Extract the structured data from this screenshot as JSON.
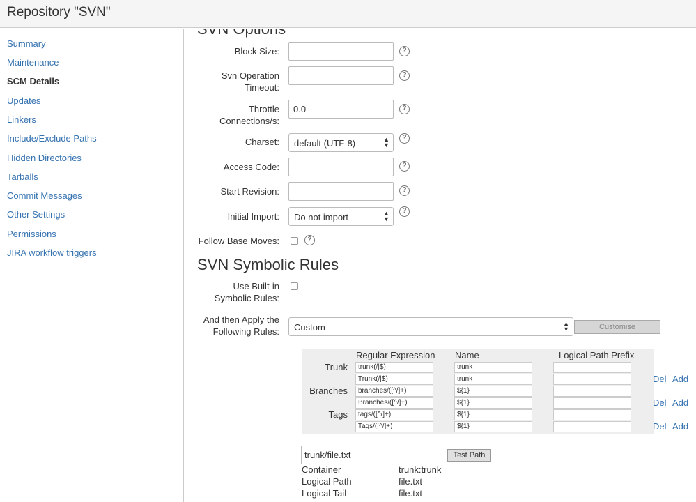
{
  "header": {
    "title": "Repository \"SVN\""
  },
  "sidebar": {
    "items": [
      {
        "label": "Summary",
        "active": false
      },
      {
        "label": "Maintenance",
        "active": false
      },
      {
        "label": "SCM Details",
        "active": true
      },
      {
        "label": "Updates",
        "active": false
      },
      {
        "label": "Linkers",
        "active": false
      },
      {
        "label": "Include/Exclude Paths",
        "active": false
      },
      {
        "label": "Hidden Directories",
        "active": false
      },
      {
        "label": "Tarballs",
        "active": false
      },
      {
        "label": "Commit Messages",
        "active": false
      },
      {
        "label": "Other Settings",
        "active": false
      },
      {
        "label": "Permissions",
        "active": false
      },
      {
        "label": "JIRA workflow triggers",
        "active": false
      }
    ]
  },
  "options": {
    "title": "SVN Options",
    "block_size": {
      "label": "Block Size:",
      "value": ""
    },
    "svn_timeout": {
      "label1": "Svn Operation",
      "label2": "Timeout:",
      "value": ""
    },
    "throttle": {
      "label1": "Throttle",
      "label2": "Connections/s:",
      "value": "0.0"
    },
    "charset": {
      "label": "Charset:",
      "value": "default (UTF-8)"
    },
    "access_code": {
      "label": "Access Code:",
      "value": ""
    },
    "start_revision": {
      "label": "Start Revision:",
      "value": ""
    },
    "initial_import": {
      "label": "Initial Import:",
      "value": "Do not import"
    },
    "follow_base": {
      "label": "Follow Base Moves:",
      "checked": false
    }
  },
  "symbolic": {
    "title": "SVN Symbolic Rules",
    "builtin": {
      "label1": "Use Built-in",
      "label2": "Symbolic Rules:",
      "checked": false
    },
    "apply": {
      "label1": "And then Apply the",
      "label2": "Following Rules:",
      "value": "Custom"
    },
    "customise_label": "Customise",
    "headers": {
      "regex": "Regular Expression",
      "name": "Name",
      "prefix": "Logical Path Prefix"
    },
    "groups": [
      "Trunk",
      "Branches",
      "Tags"
    ],
    "rows": [
      {
        "regex": "trunk(/|$)",
        "name": "trunk",
        "prefix": ""
      },
      {
        "regex": "Trunk(/|$)",
        "name": "trunk",
        "prefix": ""
      },
      {
        "regex": "branches/([^/]+)",
        "name": "${1}",
        "prefix": ""
      },
      {
        "regex": "Branches/([^/]+)",
        "name": "${1}",
        "prefix": ""
      },
      {
        "regex": "tags/([^/]+)",
        "name": "${1}",
        "prefix": ""
      },
      {
        "regex": "Tags/([^/]+)",
        "name": "${1}",
        "prefix": ""
      }
    ],
    "del_label": "Del",
    "add_label": "Add"
  },
  "test": {
    "input_value": "trunk/file.txt",
    "button_label": "Test Path",
    "results": [
      {
        "key": "Container",
        "value": "trunk:trunk"
      },
      {
        "key": "Logical Path",
        "value": "file.txt"
      },
      {
        "key": "Logical Tail",
        "value": "file.txt"
      }
    ]
  },
  "icons": {
    "help": "help-circle-icon",
    "dropdown": "select-arrows-icon"
  },
  "colors": {
    "link": "#3572b0",
    "header_bg": "#f5f5f5",
    "rules_bg": "#eeeeee"
  }
}
